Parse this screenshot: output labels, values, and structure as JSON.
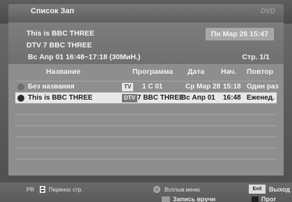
{
  "title_bar": {
    "title": "Список Зап",
    "logo": "DVD"
  },
  "info": {
    "program_title": "This is BBC THREE",
    "channel": "DTV 7 BBC THREE",
    "schedule": "Вс Апр 01 16:48~17:18 (30МиН.)",
    "datetime": "Пн Мар 26 15:47",
    "page": "Стр. 1/1"
  },
  "table": {
    "headers": {
      "name": "Название",
      "program": "Программа",
      "date": "Дата",
      "start": "Нач.",
      "repeat": "Повтор"
    },
    "rows": [
      {
        "name": "Без названия",
        "type": "TV",
        "program": "1 C 01",
        "date": "Ср Мар 28",
        "start": "15:18",
        "repeat": "Один раз"
      },
      {
        "name": "This is BBC THREE",
        "type": "DTV",
        "program": "7 BBC THREE",
        "date": "Вс Апр 01",
        "start": "16:48",
        "repeat": "Еженед."
      }
    ]
  },
  "footer": {
    "pr_label": "PR",
    "page_move": "Перенос стр.",
    "popup_menu": "Всплыв.меню",
    "exit_key": "Exit",
    "exit_label": "Выход",
    "manual_record": "Запись вручн",
    "program": "Прог"
  }
}
